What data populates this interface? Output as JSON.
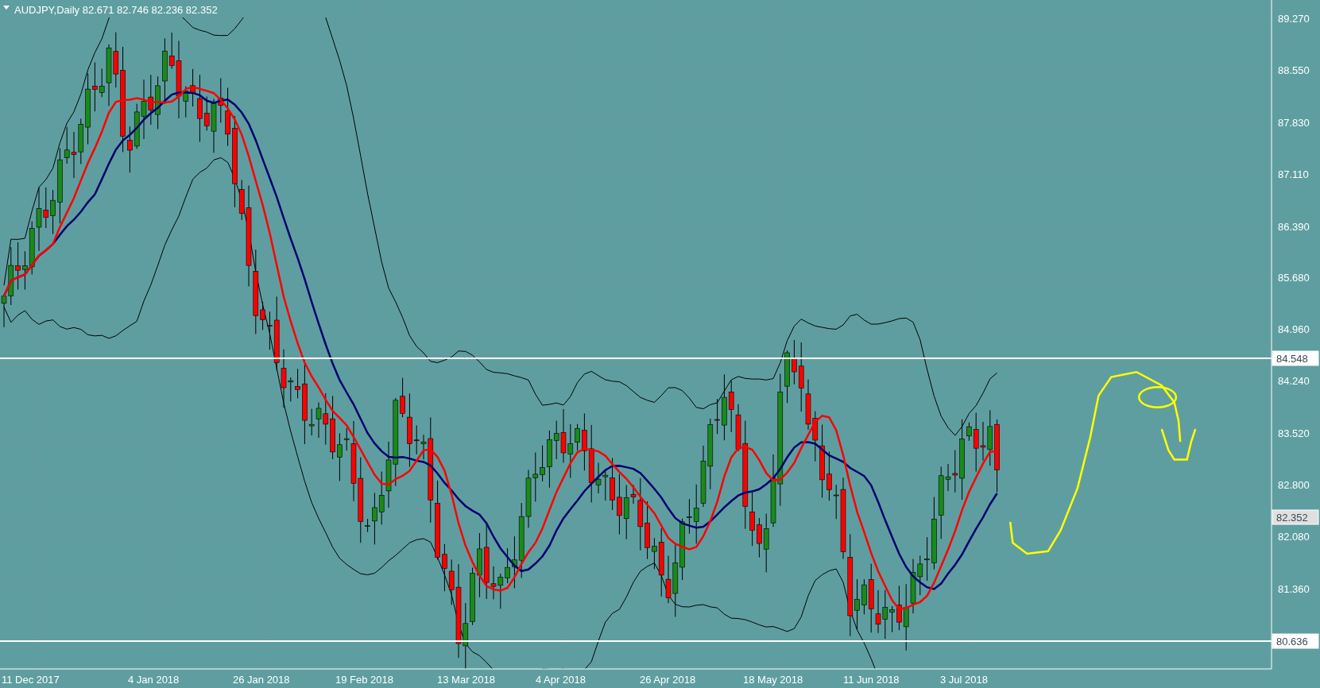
{
  "chart": {
    "symbol_info": "AUDJPY,Daily  82.671 82.746 82.236 82.352",
    "price_labels": [
      {
        "text": "89.270",
        "kind": "tick"
      },
      {
        "text": "88.550",
        "kind": "tick"
      },
      {
        "text": "87.830",
        "kind": "tick"
      },
      {
        "text": "87.110",
        "kind": "tick"
      },
      {
        "text": "86.390",
        "kind": "tick"
      },
      {
        "text": "85.680",
        "kind": "tick"
      },
      {
        "text": "84.960",
        "kind": "tick"
      },
      {
        "text": "84.548",
        "kind": "level"
      },
      {
        "text": "84.240",
        "kind": "tick"
      },
      {
        "text": "83.520",
        "kind": "tick"
      },
      {
        "text": "82.800",
        "kind": "tick"
      },
      {
        "text": "82.352",
        "kind": "current"
      },
      {
        "text": "82.080",
        "kind": "tick"
      },
      {
        "text": "81.360",
        "kind": "tick"
      },
      {
        "text": "80.636",
        "kind": "level"
      }
    ],
    "date_labels": [
      "11 Dec 2017",
      "4 Jan 2018",
      "26 Jan 2018",
      "19 Feb 2018",
      "13 Mar 2018",
      "4 Apr 2018",
      "26 Apr 2018",
      "18 May 2018",
      "11 Jun 2018",
      "3 Jul 2018"
    ]
  }
}
